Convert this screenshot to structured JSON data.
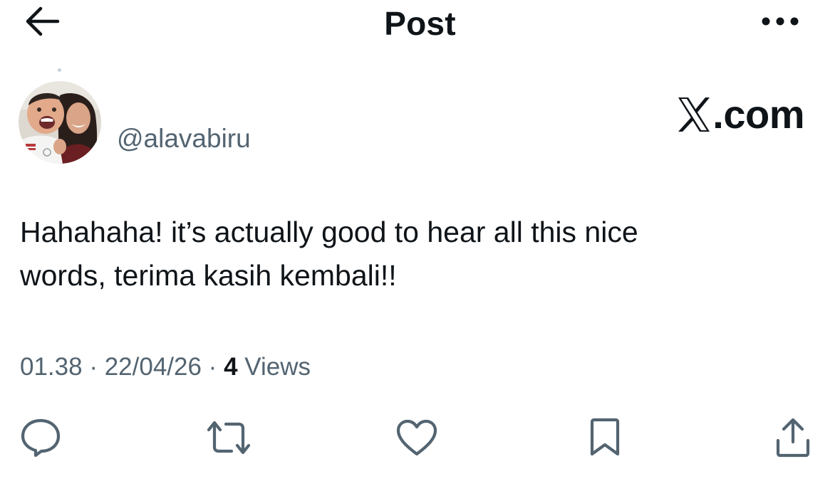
{
  "header": {
    "title": "Post",
    "back_icon": "arrow-left-icon",
    "more_icon": "more-horizontal-icon"
  },
  "author": {
    "handle": "@alavabiru",
    "avatar": "avatar-photo"
  },
  "watermark": {
    "logo_text": ".com"
  },
  "post": {
    "text_line1": "Hahahaha! it’s actually good to hear all this nice",
    "text_line2": "words, terima kasih kembali!!"
  },
  "meta": {
    "time": "01.38",
    "separator1": " · ",
    "date": "22/04/26",
    "separator2": " · ",
    "views_count": "4",
    "views_label": " Views"
  },
  "actions": [
    {
      "name": "reply",
      "icon": "reply-icon"
    },
    {
      "name": "repost",
      "icon": "repost-icon"
    },
    {
      "name": "like",
      "icon": "heart-icon"
    },
    {
      "name": "bookmark",
      "icon": "bookmark-icon"
    },
    {
      "name": "share",
      "icon": "share-icon"
    }
  ],
  "colors": {
    "text": "#0f1419",
    "secondary": "#536471",
    "icon": "#536471"
  }
}
